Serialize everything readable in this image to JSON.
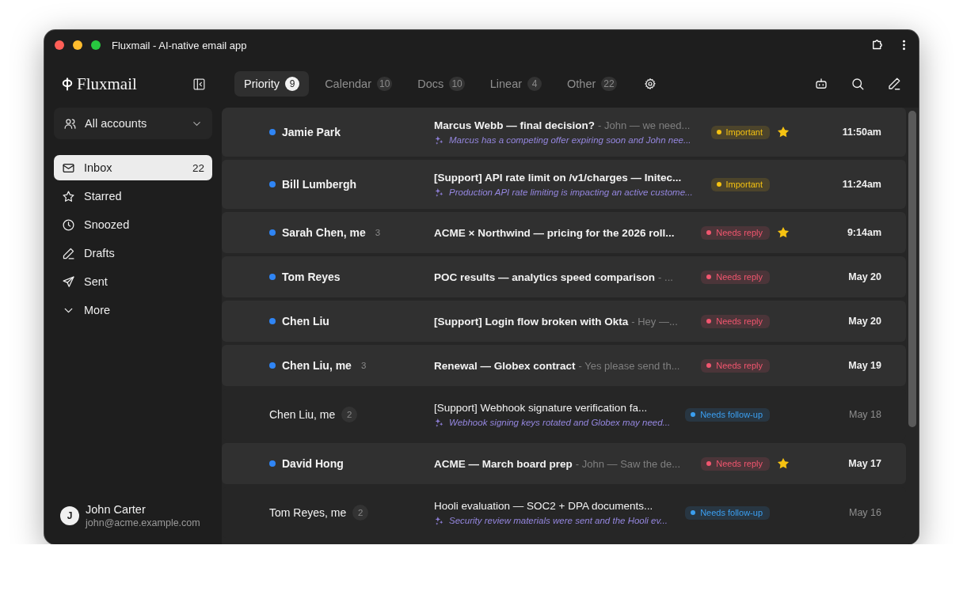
{
  "window": {
    "title": "Fluxmail - AI-native email app"
  },
  "sidebar": {
    "brand": "Fluxmail",
    "account_picker": "All accounts",
    "items": [
      {
        "label": "Inbox",
        "kind": "mail",
        "count": "22",
        "selected": true
      },
      {
        "label": "Starred",
        "kind": "star",
        "selected": false
      },
      {
        "label": "Snoozed",
        "kind": "clock",
        "selected": false
      },
      {
        "label": "Drafts",
        "kind": "pencil",
        "selected": false
      },
      {
        "label": "Sent",
        "kind": "send",
        "selected": false
      },
      {
        "label": "More",
        "kind": "chevron",
        "selected": false
      }
    ],
    "user": {
      "initial": "J",
      "name": "John Carter",
      "email": "john@acme.example.com"
    }
  },
  "tabs": [
    {
      "label": "Priority",
      "count": "9",
      "selected": true
    },
    {
      "label": "Calendar",
      "count": "10",
      "selected": false
    },
    {
      "label": "Docs",
      "count": "10",
      "selected": false
    },
    {
      "label": "Linear",
      "count": "4",
      "selected": false
    },
    {
      "label": "Other",
      "count": "22",
      "selected": false
    }
  ],
  "messages": [
    {
      "sender": "Jamie Park",
      "unread": true,
      "subject": "Marcus Webb — final decision?",
      "preview": "- John — we need...",
      "summary": "Marcus has a competing offer expiring soon and John nee...",
      "tag": {
        "label": "Important",
        "color": "#f5c211"
      },
      "starred": true,
      "time": "11:50am"
    },
    {
      "sender": "Bill Lumbergh",
      "unread": true,
      "subject": "[Support] API rate limit on /v1/charges — Initec...",
      "summary": "Production API rate limiting is impacting an active custome...",
      "tag": {
        "label": "Important",
        "color": "#f5c211"
      },
      "starred": false,
      "time": "11:24am"
    },
    {
      "sender": "Sarah Chen, me",
      "unread": true,
      "thread_count": "3",
      "subject": "ACME × Northwind — pricing for the 2026 roll...",
      "tag": {
        "label": "Needs reply",
        "color": "#f2566f"
      },
      "starred": true,
      "time": "9:14am"
    },
    {
      "sender": "Tom Reyes",
      "unread": true,
      "subject": "POC results — analytics speed comparison",
      "preview": "- ...",
      "tag": {
        "label": "Needs reply",
        "color": "#f2566f"
      },
      "starred": false,
      "time": "May 20"
    },
    {
      "sender": "Chen Liu",
      "unread": true,
      "subject": "[Support] Login flow broken with Okta",
      "preview": "- Hey —...",
      "tag": {
        "label": "Needs reply",
        "color": "#f2566f"
      },
      "starred": false,
      "time": "May 20"
    },
    {
      "sender": "Chen Liu, me",
      "unread": true,
      "thread_count": "3",
      "subject": "Renewal — Globex contract",
      "preview": "- Yes please send th...",
      "tag": {
        "label": "Needs reply",
        "color": "#f2566f"
      },
      "starred": false,
      "time": "May 19"
    },
    {
      "sender": "Chen Liu, me",
      "unread": false,
      "thread_count": "2",
      "subject": "[Support] Webhook signature verification fa...",
      "summary": "Webhook signing keys rotated and Globex may need...",
      "tag": {
        "label": "Needs follow-up",
        "color": "#3b9ff0"
      },
      "starred": false,
      "time": "May 18"
    },
    {
      "sender": "David Hong",
      "unread": true,
      "subject": "ACME — March board prep",
      "preview": "- John — Saw the de...",
      "tag": {
        "label": "Needs reply",
        "color": "#f2566f"
      },
      "starred": true,
      "time": "May 17"
    },
    {
      "sender": "Tom Reyes, me",
      "unread": false,
      "thread_count": "2",
      "subject": "Hooli evaluation — SOC2 + DPA documents...",
      "summary": "Security review materials were sent and the Hooli ev...",
      "tag": {
        "label": "Needs follow-up",
        "color": "#3b9ff0"
      },
      "starred": false,
      "time": "May 16"
    }
  ]
}
